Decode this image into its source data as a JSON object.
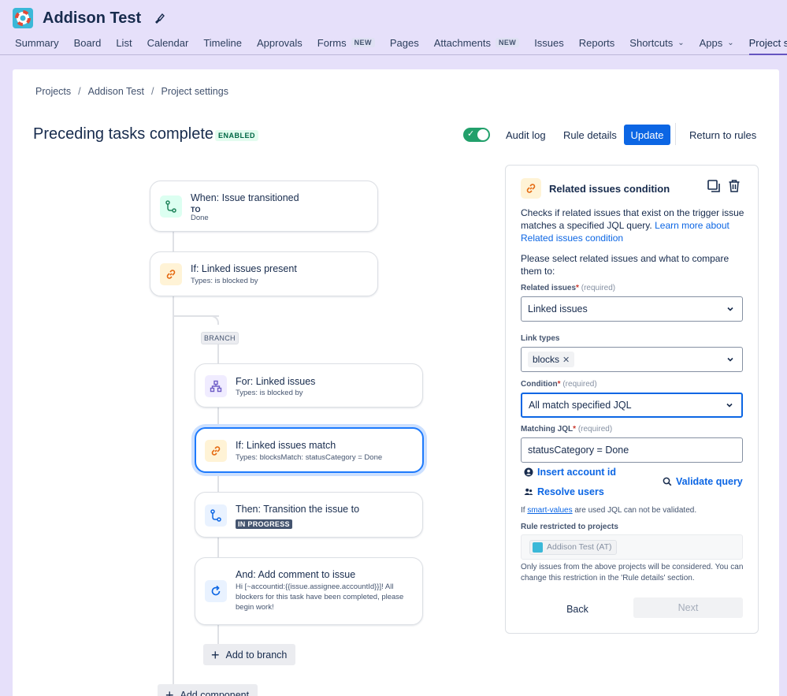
{
  "project": {
    "name": "Addison Test"
  },
  "nav": {
    "items": [
      {
        "label": "Summary"
      },
      {
        "label": "Board"
      },
      {
        "label": "List"
      },
      {
        "label": "Calendar"
      },
      {
        "label": "Timeline"
      },
      {
        "label": "Approvals"
      },
      {
        "label": "Forms",
        "badge": "NEW"
      },
      {
        "label": "Pages"
      },
      {
        "label": "Attachments",
        "badge": "NEW"
      },
      {
        "label": "Issues"
      },
      {
        "label": "Reports"
      },
      {
        "label": "Shortcuts"
      },
      {
        "label": "Apps"
      },
      {
        "label": "Project settings"
      }
    ],
    "active": "Project settings"
  },
  "breadcrumbs": [
    "Projects",
    "Addison Test",
    "Project settings"
  ],
  "rule": {
    "title": "Preceding tasks complete",
    "status_badge": "ENABLED",
    "enabled": true,
    "audit_log_label": "Audit log",
    "rule_details_label": "Rule details",
    "update_label": "Update",
    "return_label": "Return to rules"
  },
  "flow": {
    "trigger": {
      "title": "When: Issue transitioned",
      "to_label": "TO",
      "to_value": "Done"
    },
    "condition": {
      "title": "If: Linked issues present",
      "sub": "Types: is blocked by"
    },
    "branch_label": "BRANCH",
    "branch": {
      "title": "For: Linked issues",
      "sub": "Types: is blocked by"
    },
    "match": {
      "title": "If: Linked issues match",
      "sub": "Types: blocksMatch: statusCategory = Done"
    },
    "transition": {
      "title": "Then: Transition the issue to",
      "status": "IN PROGRESS"
    },
    "comment": {
      "title": "And: Add comment to issue",
      "body": "Hi [~accountid:{{issue.assignee.accountId}}]! All blockers for this task have been completed, please begin work!"
    },
    "add_to_branch": "Add to branch",
    "add_component": "Add component"
  },
  "side_panel": {
    "title": "Related issues condition",
    "description": "Checks if related issues that exist on the trigger issue matches a specified JQL query.",
    "learn_more": "Learn more about Related issues condition",
    "prompt": "Please select related issues and what to compare them to:",
    "related_label": "Related issues",
    "required_text": "(required)",
    "related_value": "Linked issues",
    "link_types_label": "Link types",
    "link_type_chip": "blocks",
    "condition_label": "Condition",
    "condition_value": "All match specified JQL",
    "jql_label": "Matching JQL",
    "jql_value": "statusCategory = Done",
    "insert_account": "Insert account id",
    "validate_query": "Validate query",
    "resolve_users": "Resolve users",
    "smart_note_pre": "If",
    "smart_link": "smart-values",
    "smart_note_post": "are used JQL can not be validated.",
    "restricted_label": "Rule restricted to projects",
    "restricted_value": "Addison Test (AT)",
    "restricted_note": "Only issues from the above projects will be considered. You can change this restriction in the 'Rule details' section.",
    "back_label": "Back",
    "next_label": "Next"
  },
  "colors": {
    "page_bg": "#e6e0fa",
    "primary": "#0c66e4",
    "toggle_on": "#22a06b",
    "selected_border": "#1d7afc"
  }
}
